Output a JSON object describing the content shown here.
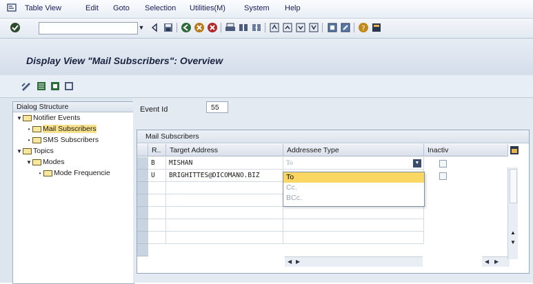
{
  "menu": {
    "items": [
      "Table View",
      "Edit",
      "Goto",
      "Selection",
      "Utilities(M)",
      "System",
      "Help"
    ]
  },
  "toolbar": {
    "command_value": ""
  },
  "title": "Display View \"Mail Subscribers\": Overview",
  "tree": {
    "header": "Dialog Structure",
    "nodes": [
      {
        "label": "Notifier Events"
      },
      {
        "label": "Mail Subscribers"
      },
      {
        "label": "SMS Subscribers"
      },
      {
        "label": "Topics"
      },
      {
        "label": "Modes"
      },
      {
        "label": "Mode Frequencie"
      }
    ]
  },
  "event": {
    "label": "Event Id",
    "value": "55"
  },
  "grid": {
    "title": "Mail Subscribers",
    "columns": [
      "R..",
      "Target Address",
      "Addressee Type",
      "Inactiv"
    ],
    "rows": [
      {
        "r": "B",
        "address": "MISHAN",
        "type": "To"
      },
      {
        "r": "U",
        "address": "BRIGHITTES@DICOMANO.BIZ",
        "type": ""
      }
    ]
  },
  "dropdown": {
    "options": [
      "To",
      "Cc.",
      "BCc."
    ],
    "highlighted": "To"
  },
  "colors": {
    "accent": "#f9d762",
    "header_bg": "#dbe3ed",
    "tree_selected": "#f9e08a"
  }
}
